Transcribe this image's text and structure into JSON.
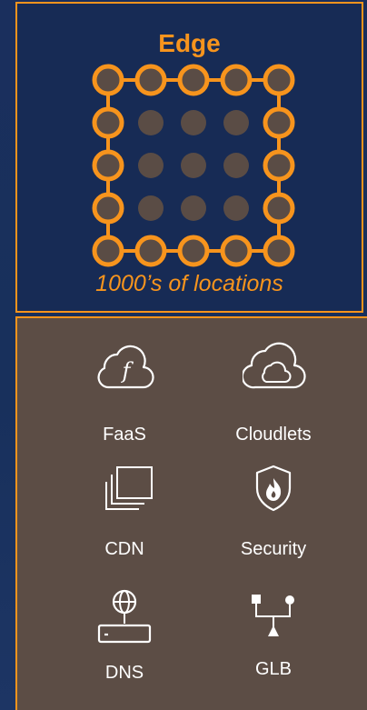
{
  "edge": {
    "title": "Edge",
    "subtitle": "1000’s of locations"
  },
  "colors": {
    "accent": "#f7941d",
    "background": "#1b2f5c",
    "services_panel": "#5c4d45",
    "node_fill": "#5a4c45"
  },
  "services": {
    "faas": {
      "label": "FaaS",
      "icon": "function-cloud-icon"
    },
    "cloudlets": {
      "label": "Cloudlets",
      "icon": "nested-cloud-icon"
    },
    "cdn": {
      "label": "CDN",
      "icon": "stacked-windows-icon"
    },
    "security": {
      "label": "Security",
      "icon": "fire-shield-icon"
    },
    "dns": {
      "label": "DNS",
      "icon": "globe-server-icon"
    },
    "glb": {
      "label": "GLB",
      "icon": "load-balancer-icon"
    }
  }
}
